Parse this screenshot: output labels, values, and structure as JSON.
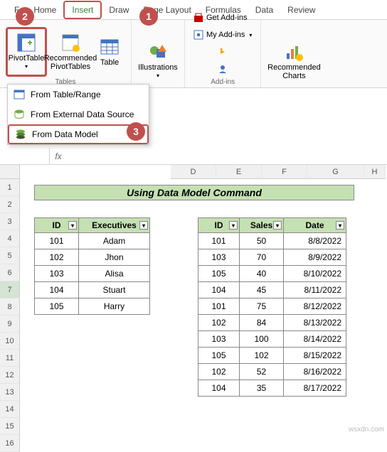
{
  "tabs": {
    "file": "F",
    "home": "Home",
    "insert": "Insert",
    "draw": "Draw",
    "pagelayout": "Page Layout",
    "formulas": "Formulas",
    "data": "Data",
    "review": "Review"
  },
  "ribbon": {
    "pivottable": "PivotTable",
    "recommended": "Recommended\nPivotTables",
    "table": "Table",
    "tables_group": "Tables",
    "illustrations": "Illustrations",
    "getaddins": "Get Add-ins",
    "myaddins": "My Add-ins",
    "addins_group": "Add-ins",
    "reccharts": "Recommended\nCharts"
  },
  "dropdown": {
    "range": "From Table/Range",
    "external": "From External Data Source",
    "model": "From Data Model"
  },
  "callouts": {
    "c1": "1",
    "c2": "2",
    "c3": "3"
  },
  "formula": {
    "fx": "fx"
  },
  "col_headers": [
    "D",
    "E",
    "F",
    "G",
    "H"
  ],
  "row_headers": [
    "1",
    "2",
    "3",
    "4",
    "5",
    "6",
    "7",
    "8",
    "9",
    "10",
    "11",
    "12",
    "13",
    "14",
    "15",
    "16"
  ],
  "title": "Using Data Model Command",
  "table1": {
    "headers": [
      "ID",
      "Executives"
    ],
    "rows": [
      [
        "101",
        "Adam"
      ],
      [
        "102",
        "Jhon"
      ],
      [
        "103",
        "Alisa"
      ],
      [
        "104",
        "Stuart"
      ],
      [
        "105",
        "Harry"
      ]
    ]
  },
  "table2": {
    "headers": [
      "ID",
      "Sales",
      "Date"
    ],
    "rows": [
      [
        "101",
        "50",
        "8/8/2022"
      ],
      [
        "103",
        "70",
        "8/9/2022"
      ],
      [
        "105",
        "40",
        "8/10/2022"
      ],
      [
        "104",
        "45",
        "8/11/2022"
      ],
      [
        "101",
        "75",
        "8/12/2022"
      ],
      [
        "102",
        "84",
        "8/13/2022"
      ],
      [
        "103",
        "100",
        "8/14/2022"
      ],
      [
        "105",
        "102",
        "8/15/2022"
      ],
      [
        "102",
        "52",
        "8/16/2022"
      ],
      [
        "104",
        "35",
        "8/17/2022"
      ]
    ]
  },
  "watermark": "wsxdn.com"
}
